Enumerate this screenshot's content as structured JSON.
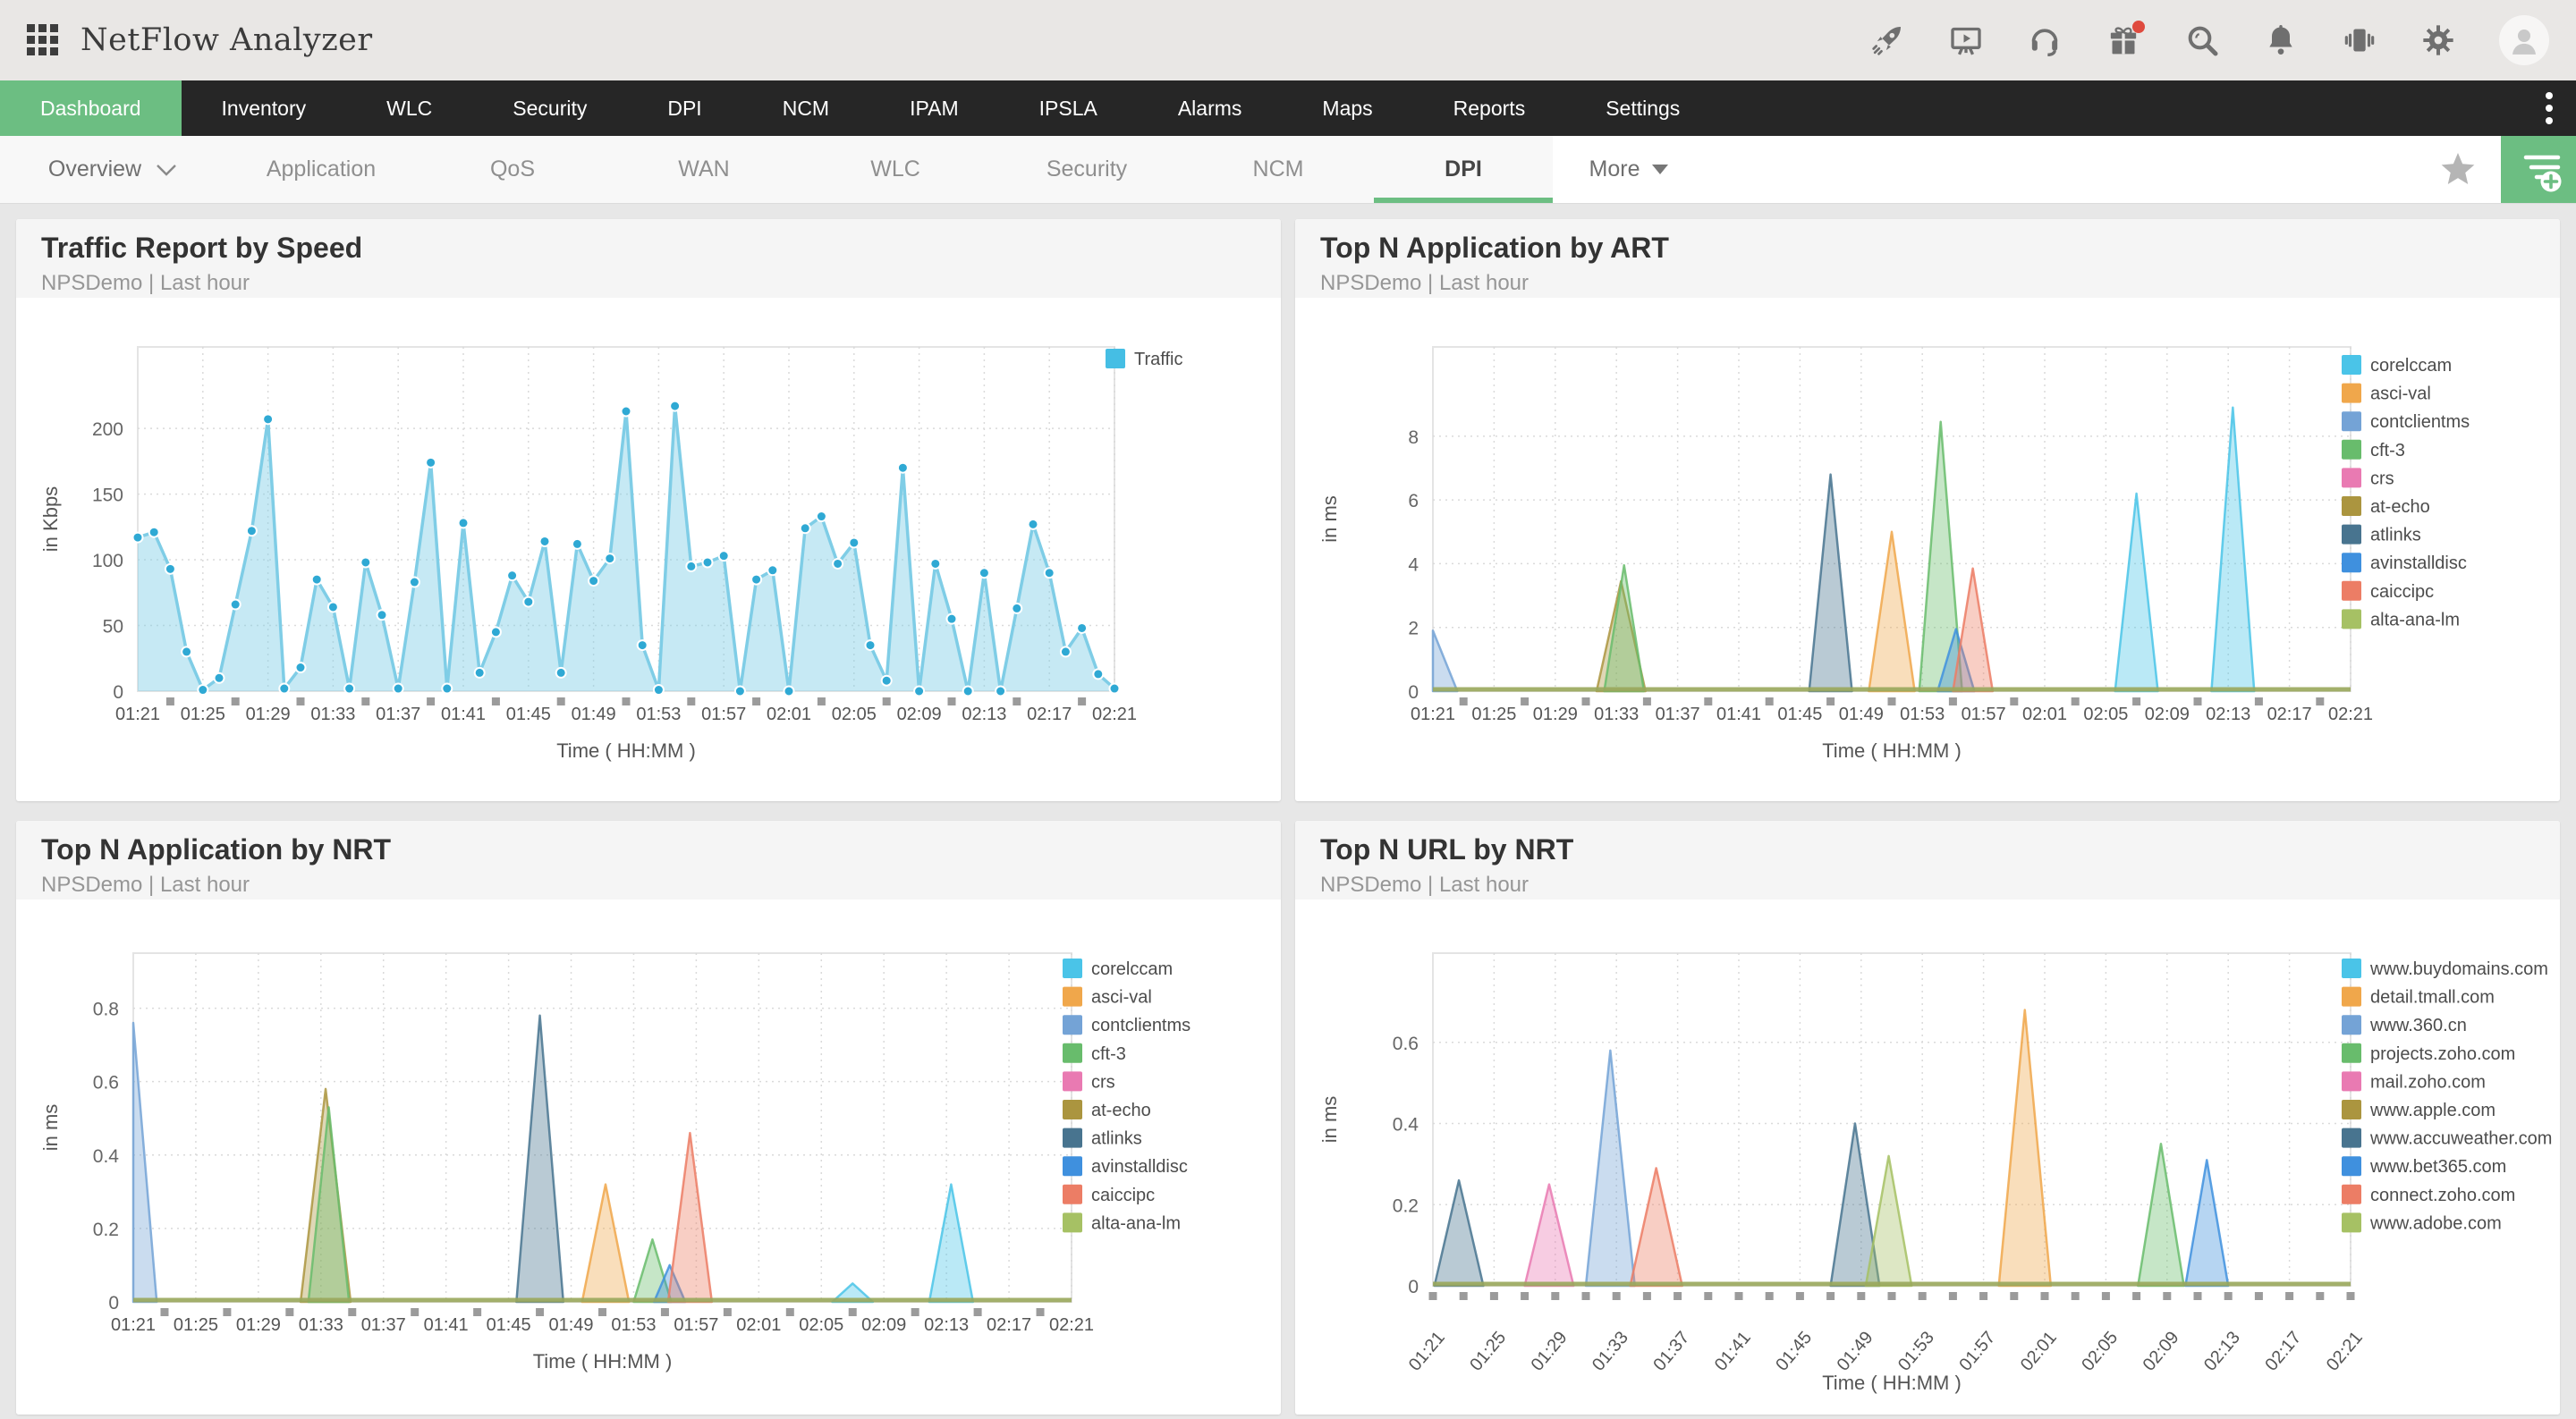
{
  "header": {
    "app_title": "NetFlow Analyzer",
    "icons": [
      "apps-grid",
      "rocket",
      "demo-screen",
      "headset",
      "gift",
      "search",
      "bell",
      "vibrate",
      "settings",
      "user"
    ],
    "gift_badge_color": "#df4a3e"
  },
  "navbar": {
    "accent_color": "#6cbe82",
    "items": [
      {
        "label": "Dashboard",
        "active": true
      },
      {
        "label": "Inventory",
        "active": false
      },
      {
        "label": "WLC",
        "active": false
      },
      {
        "label": "Security",
        "active": false
      },
      {
        "label": "DPI",
        "active": false
      },
      {
        "label": "NCM",
        "active": false
      },
      {
        "label": "IPAM",
        "active": false
      },
      {
        "label": "IPSLA",
        "active": false
      },
      {
        "label": "Alarms",
        "active": false
      },
      {
        "label": "Maps",
        "active": false
      },
      {
        "label": "Reports",
        "active": false
      },
      {
        "label": "Settings",
        "active": false
      }
    ]
  },
  "subnav": {
    "overview_label": "Overview",
    "tabs": [
      {
        "label": "Application",
        "active": false
      },
      {
        "label": "QoS",
        "active": false
      },
      {
        "label": "WAN",
        "active": false
      },
      {
        "label": "WLC",
        "active": false
      },
      {
        "label": "Security",
        "active": false
      },
      {
        "label": "NCM",
        "active": false
      },
      {
        "label": "DPI",
        "active": true
      }
    ],
    "more_label": "More"
  },
  "panels": [
    {
      "title": "Traffic Report by Speed",
      "subtitle": "NPSDemo | Last hour"
    },
    {
      "title": "Top N Application by ART",
      "subtitle": "NPSDemo | Last hour"
    },
    {
      "title": "Top N Application by NRT",
      "subtitle": "NPSDemo | Last hour"
    },
    {
      "title": "Top N URL by NRT",
      "subtitle": "NPSDemo | Last hour"
    }
  ],
  "chart_data": [
    {
      "type": "area",
      "title": "Traffic Report by Speed",
      "ylabel": "in Kbps",
      "xlabel": "Time ( HH:MM )",
      "yticks": [
        0,
        50,
        100,
        150,
        200
      ],
      "ymax": 262,
      "x_labels": [
        "01:21",
        "01:25",
        "01:29",
        "01:33",
        "01:37",
        "01:41",
        "01:45",
        "01:49",
        "01:53",
        "01:57",
        "02:01",
        "02:05",
        "02:09",
        "02:13",
        "02:17",
        "02:21"
      ],
      "interval_min": 1,
      "grid": true,
      "legend_pos": "right",
      "legend": [
        {
          "label": "Traffic",
          "color": "#45bee4"
        }
      ],
      "series": [
        {
          "name": "Traffic",
          "color": "#45bee4",
          "line_color": "#7fcde6",
          "fill_color": "rgba(129,206,230,0.45)",
          "marker_color": "#2fa9d4",
          "values": [
            117,
            121,
            93,
            30,
            1,
            10,
            66,
            122,
            207,
            2,
            18,
            85,
            64,
            2,
            98,
            58,
            2,
            83,
            174,
            2,
            128,
            14,
            45,
            88,
            68,
            114,
            14,
            112,
            84,
            101,
            213,
            35,
            1,
            217,
            95,
            98,
            103,
            0,
            85,
            92,
            0,
            124,
            133,
            97,
            113,
            35,
            8,
            170,
            0,
            97,
            55,
            0,
            90,
            0,
            63,
            127,
            90,
            30,
            48,
            13,
            2
          ]
        }
      ]
    },
    {
      "type": "spike",
      "title": "Top N Application by ART",
      "ylabel": "in ms",
      "xlabel": "Time ( HH:MM )",
      "yticks": [
        0,
        2,
        4,
        6,
        8
      ],
      "ymax": 10.8,
      "x_labels": [
        "01:21",
        "01:25",
        "01:29",
        "01:33",
        "01:37",
        "01:41",
        "01:45",
        "01:49",
        "01:53",
        "01:57",
        "02:01",
        "02:05",
        "02:09",
        "02:13",
        "02:17",
        "02:21"
      ],
      "grid": true,
      "legend_pos": "right",
      "baseline_color": "#9aa85c",
      "legend": [
        {
          "label": "corelccam",
          "color": "#4ac4e8"
        },
        {
          "label": "asci-val",
          "color": "#f0a74b"
        },
        {
          "label": "contclientms",
          "color": "#74a3d6"
        },
        {
          "label": "cft-3",
          "color": "#68bc6c"
        },
        {
          "label": "crs",
          "color": "#e97ab2"
        },
        {
          "label": "at-echo",
          "color": "#ab953f"
        },
        {
          "label": "atlinks",
          "color": "#48748f"
        },
        {
          "label": "avinstalldisc",
          "color": "#3f90de"
        },
        {
          "label": "caiccipc",
          "color": "#ec7d65"
        },
        {
          "label": "alta-ana-lm",
          "color": "#a6c164"
        }
      ],
      "spikes": [
        {
          "i": 2,
          "t": 0,
          "peak": 1.9,
          "w": 1.6
        },
        {
          "i": 5,
          "t": 12.3,
          "peak": 3.45,
          "w": 1.6
        },
        {
          "i": 3,
          "t": 12.5,
          "peak": 3.95,
          "w": 1.3
        },
        {
          "i": 6,
          "t": 26,
          "peak": 6.8,
          "w": 1.4
        },
        {
          "i": 1,
          "t": 30,
          "peak": 5.0,
          "w": 1.5
        },
        {
          "i": 3,
          "t": 33.2,
          "peak": 8.45,
          "w": 1.4
        },
        {
          "i": 7,
          "t": 34.2,
          "peak": 1.95,
          "w": 1.2
        },
        {
          "i": 8,
          "t": 35.3,
          "peak": 3.85,
          "w": 1.3
        },
        {
          "i": 0,
          "t": 46,
          "peak": 6.2,
          "w": 1.4
        },
        {
          "i": 0,
          "t": 52.3,
          "peak": 8.9,
          "w": 1.4
        }
      ]
    },
    {
      "type": "spike",
      "title": "Top N Application by NRT",
      "ylabel": "in ms",
      "xlabel": "Time ( HH:MM )",
      "yticks": [
        0,
        0.2,
        0.4,
        0.6,
        0.8
      ],
      "ymax": 0.95,
      "x_labels": [
        "01:21",
        "01:25",
        "01:29",
        "01:33",
        "01:37",
        "01:41",
        "01:45",
        "01:49",
        "01:53",
        "01:57",
        "02:01",
        "02:05",
        "02:09",
        "02:13",
        "02:17",
        "02:21"
      ],
      "grid": true,
      "legend_pos": "right",
      "baseline_color": "#9aa85c",
      "legend": [
        {
          "label": "corelccam",
          "color": "#4ac4e8"
        },
        {
          "label": "asci-val",
          "color": "#f0a74b"
        },
        {
          "label": "contclientms",
          "color": "#74a3d6"
        },
        {
          "label": "cft-3",
          "color": "#68bc6c"
        },
        {
          "label": "crs",
          "color": "#e97ab2"
        },
        {
          "label": "at-echo",
          "color": "#ab953f"
        },
        {
          "label": "atlinks",
          "color": "#48748f"
        },
        {
          "label": "avinstalldisc",
          "color": "#3f90de"
        },
        {
          "label": "caiccipc",
          "color": "#ec7d65"
        },
        {
          "label": "alta-ana-lm",
          "color": "#a6c164"
        }
      ],
      "spikes": [
        {
          "i": 2,
          "t": 0,
          "peak": 0.76,
          "w": 1.5
        },
        {
          "i": 5,
          "t": 12.3,
          "peak": 0.58,
          "w": 1.6
        },
        {
          "i": 3,
          "t": 12.5,
          "peak": 0.53,
          "w": 1.3
        },
        {
          "i": 6,
          "t": 26,
          "peak": 0.78,
          "w": 1.5
        },
        {
          "i": 1,
          "t": 30.2,
          "peak": 0.32,
          "w": 1.5
        },
        {
          "i": 3,
          "t": 33.2,
          "peak": 0.17,
          "w": 1.2
        },
        {
          "i": 7,
          "t": 34.3,
          "peak": 0.1,
          "w": 1.0
        },
        {
          "i": 8,
          "t": 35.6,
          "peak": 0.46,
          "w": 1.4
        },
        {
          "i": 0,
          "t": 46,
          "peak": 0.05,
          "w": 1.3
        },
        {
          "i": 0,
          "t": 52.3,
          "peak": 0.32,
          "w": 1.4
        }
      ]
    },
    {
      "type": "spike",
      "title": "Top N URL by NRT",
      "ylabel": "in ms",
      "xlabel": "Time ( HH:MM )",
      "yticks": [
        0,
        0.2,
        0.4,
        0.6
      ],
      "ymax": 0.82,
      "x_labels": [
        "01:21",
        "01:25",
        "01:29",
        "01:33",
        "01:37",
        "01:41",
        "01:45",
        "01:49",
        "01:53",
        "01:57",
        "02:01",
        "02:05",
        "02:09",
        "02:13",
        "02:17",
        "02:21"
      ],
      "grid": true,
      "rotated_x_labels": true,
      "legend_pos": "right",
      "baseline_color": "#9aa85c",
      "legend": [
        {
          "label": "www.buydomains.com",
          "color": "#4ac4e8"
        },
        {
          "label": "detail.tmall.com",
          "color": "#f0a74b"
        },
        {
          "label": "www.360.cn",
          "color": "#74a3d6"
        },
        {
          "label": "projects.zoho.com",
          "color": "#68bc6c"
        },
        {
          "label": "mail.zoho.com",
          "color": "#e97ab2"
        },
        {
          "label": "www.apple.com",
          "color": "#ab953f"
        },
        {
          "label": "www.accuweather.com",
          "color": "#48748f"
        },
        {
          "label": "www.bet365.com",
          "color": "#3f90de"
        },
        {
          "label": "connect.zoho.com",
          "color": "#ec7d65"
        },
        {
          "label": "www.adobe.com",
          "color": "#a6c164"
        }
      ],
      "spikes": [
        {
          "i": 6,
          "t": 1.7,
          "peak": 0.26,
          "w": 1.6
        },
        {
          "i": 4,
          "t": 7.6,
          "peak": 0.25,
          "w": 1.6
        },
        {
          "i": 2,
          "t": 11.6,
          "peak": 0.58,
          "w": 1.6
        },
        {
          "i": 8,
          "t": 14.6,
          "peak": 0.29,
          "w": 1.7
        },
        {
          "i": 6,
          "t": 27.6,
          "peak": 0.4,
          "w": 1.6
        },
        {
          "i": 9,
          "t": 29.8,
          "peak": 0.32,
          "w": 1.5
        },
        {
          "i": 1,
          "t": 38.7,
          "peak": 0.68,
          "w": 1.7
        },
        {
          "i": 3,
          "t": 47.6,
          "peak": 0.35,
          "w": 1.5
        },
        {
          "i": 7,
          "t": 50.6,
          "peak": 0.31,
          "w": 1.4
        }
      ]
    }
  ]
}
